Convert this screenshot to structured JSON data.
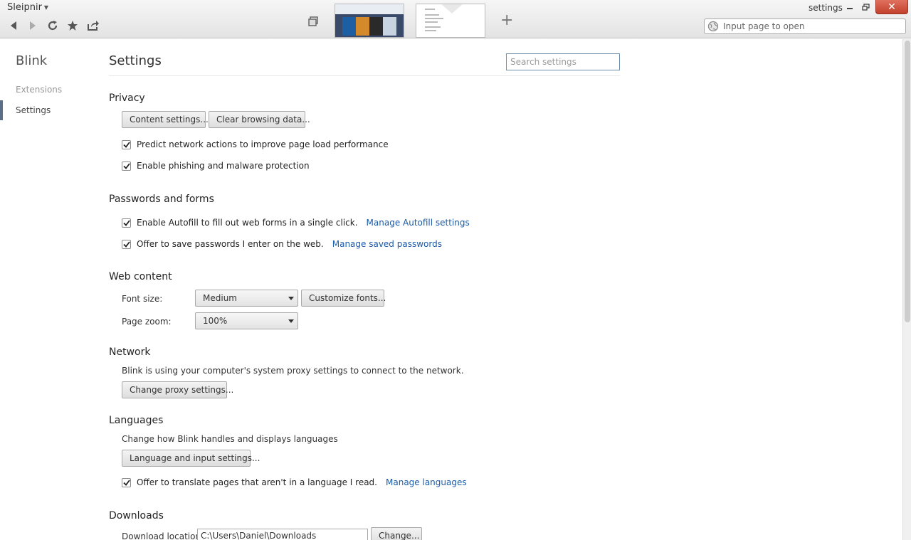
{
  "browser": {
    "app_name": "Sleipnir",
    "window_title": "settings",
    "address_placeholder": "Input page to open"
  },
  "sidebar": {
    "brand": "Blink",
    "items": [
      {
        "label": "Extensions"
      },
      {
        "label": "Settings"
      }
    ]
  },
  "header": {
    "title": "Settings",
    "search_placeholder": "Search settings"
  },
  "privacy": {
    "title": "Privacy",
    "content_settings_btn": "Content settings...",
    "clear_data_btn": "Clear browsing data...",
    "predict_label": "Predict network actions to improve page load performance",
    "phishing_label": "Enable phishing and malware protection"
  },
  "passwords": {
    "title": "Passwords and forms",
    "autofill_label": "Enable Autofill to fill out web forms in a single click.",
    "autofill_link": "Manage Autofill settings",
    "save_pw_label": "Offer to save passwords I enter on the web.",
    "save_pw_link": "Manage saved passwords"
  },
  "web_content": {
    "title": "Web content",
    "font_size_label": "Font size:",
    "font_size_value": "Medium",
    "customize_fonts_btn": "Customize fonts...",
    "zoom_label": "Page zoom:",
    "zoom_value": "100%"
  },
  "network": {
    "title": "Network",
    "description": "Blink is using your computer's system proxy settings to connect to the network.",
    "proxy_btn": "Change proxy settings..."
  },
  "languages": {
    "title": "Languages",
    "description": "Change how Blink handles and displays languages",
    "lang_btn": "Language and input settings...",
    "translate_label": "Offer to translate pages that aren't in a language I read.",
    "translate_link": "Manage languages"
  },
  "downloads": {
    "title": "Downloads",
    "location_label": "Download location:",
    "location_value": "C:\\Users\\Daniel\\Downloads",
    "change_btn": "Change..."
  },
  "colors": {
    "link": "#1a5aa8",
    "sidebar_marker": "#5a6e87",
    "close_button": "#c2412d"
  }
}
